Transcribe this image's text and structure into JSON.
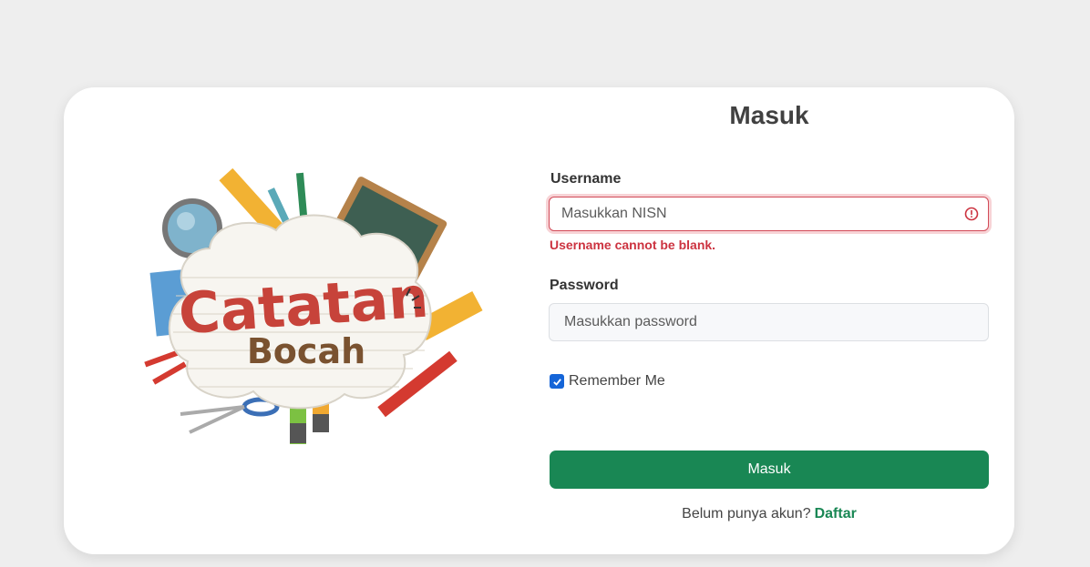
{
  "login": {
    "title": "Masuk",
    "logo": {
      "line1": "Catatan",
      "line2": "Bocah"
    },
    "username": {
      "label": "Username",
      "placeholder": "Masukkan NISN",
      "error": "Username cannot be blank."
    },
    "password": {
      "label": "Password",
      "placeholder": "Masukkan password"
    },
    "remember_label": "Remember Me",
    "remember_checked": true,
    "submit_label": "Masuk",
    "signup_prompt": "Belum punya akun?",
    "signup_link": "Daftar"
  },
  "colors": {
    "primary": "#198754",
    "error": "#cc3340",
    "checkbox": "#1565d8",
    "background": "#eeeeee"
  }
}
